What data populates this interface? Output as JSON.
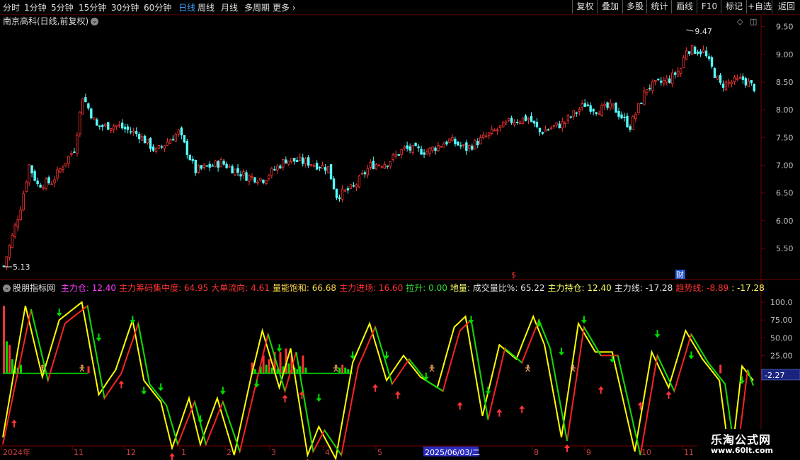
{
  "toolbar": {
    "timeframes": [
      "分时",
      "1分钟",
      "5分钟",
      "15分钟",
      "30分钟",
      "60分钟",
      "日线",
      "周线",
      "月线",
      "多周期",
      "更多"
    ],
    "active_timeframe": "日线",
    "buttons": [
      "复权",
      "叠加",
      "多股",
      "统计",
      "画线",
      "F10",
      "标记",
      "+自选",
      "返回"
    ]
  },
  "stock_title": "南京高科(日线,前复权)",
  "indicator": {
    "name": "股朋指标网",
    "fields": [
      {
        "label": "主力仓:",
        "value": "12.40",
        "color": "#ff40ff"
      },
      {
        "label": "主力筹码集中度:",
        "value": "64.95",
        "color": "#ff3333"
      },
      {
        "label": "大单流向:",
        "value": "4.61",
        "color": "#ff3333"
      },
      {
        "label": "量能饱和:",
        "value": "66.68",
        "color": "#ffd84a"
      },
      {
        "label": "主力进场:",
        "value": "16.60",
        "color": "#ff3333"
      },
      {
        "label": "拉升:",
        "value": "0.00",
        "color": "#33dd33"
      },
      {
        "label": "地量:",
        "value": "",
        "color": "#ffff66"
      },
      {
        "label": "成交量比%:",
        "value": "65.22",
        "color": "#e0e0e0"
      },
      {
        "label": "主力持仓:",
        "value": "12.40",
        "color": "#ffff66"
      },
      {
        "label": "主力线:",
        "value": "-17.28",
        "color": "#e0e0e0"
      },
      {
        "label": "趋势线:",
        "value": "-8.89",
        "color": "#ff3333"
      },
      {
        "label": ":",
        "value": "-17.28",
        "color": "#ffff66"
      }
    ],
    "current_value_badge": "-2.27"
  },
  "markers": {
    "high_label": "9.47",
    "low_label": "5.13",
    "event_letter": "$",
    "event_char": "财"
  },
  "watermark": {
    "title": "乐淘公式网",
    "url": "www.60lt.com"
  },
  "colors": {
    "up": "#ff3333",
    "down": "#54ffff",
    "yellow": "#ffff00",
    "green": "#00e000",
    "grid": "#7a0000",
    "axis_text": "#c0c0c0"
  },
  "chart_data": [
    {
      "type": "candlestick",
      "title": "南京高科(日线,前复权)",
      "ylim": [
        5.13,
        9.47
      ],
      "y_ticks": [
        5.5,
        6.0,
        6.5,
        7.0,
        7.5,
        8.0,
        8.5,
        9.0,
        9.5
      ],
      "x_labels": [
        "2024年",
        "11",
        "12",
        "1",
        "2",
        "3",
        "4",
        "5",
        "2025/06/03/二",
        "8",
        "9",
        "10",
        "11"
      ],
      "highlighted_x_label": "2025/06/03/二",
      "close_anchors": [
        [
          0,
          5.18
        ],
        [
          6,
          6.25
        ],
        [
          9,
          7.0
        ],
        [
          12,
          6.65
        ],
        [
          17,
          6.7
        ],
        [
          25,
          7.3
        ],
        [
          28,
          8.25
        ],
        [
          33,
          7.7
        ],
        [
          40,
          7.72
        ],
        [
          48,
          7.55
        ],
        [
          54,
          7.25
        ],
        [
          62,
          7.6
        ],
        [
          68,
          6.9
        ],
        [
          77,
          7.05
        ],
        [
          86,
          6.8
        ],
        [
          92,
          6.75
        ],
        [
          100,
          7.1
        ],
        [
          108,
          7.05
        ],
        [
          115,
          6.95
        ],
        [
          118,
          6.45
        ],
        [
          124,
          6.6
        ],
        [
          130,
          7.0
        ],
        [
          136,
          7.05
        ],
        [
          142,
          7.3
        ],
        [
          150,
          7.25
        ],
        [
          158,
          7.45
        ],
        [
          164,
          7.3
        ],
        [
          172,
          7.55
        ],
        [
          180,
          7.8
        ],
        [
          186,
          7.85
        ],
        [
          190,
          7.6
        ],
        [
          198,
          7.75
        ],
        [
          206,
          8.1
        ],
        [
          210,
          8.0
        ],
        [
          216,
          8.05
        ],
        [
          222,
          7.7
        ],
        [
          228,
          8.4
        ],
        [
          236,
          8.55
        ],
        [
          240,
          8.75
        ],
        [
          242,
          9.1
        ],
        [
          248,
          9.05
        ],
        [
          254,
          8.45
        ],
        [
          262,
          8.55
        ],
        [
          266,
          8.4
        ]
      ],
      "n_bars": 267
    },
    {
      "type": "line",
      "title": "股朋指标网",
      "ylim": [
        -100,
        115
      ],
      "y_ticks": [
        0.0,
        25.0,
        50.0,
        75.0,
        100.0
      ],
      "series": [
        {
          "name": "",
          "color": "#ffff00",
          "points": [
            [
              0,
              -90
            ],
            [
              8,
              95
            ],
            [
              14,
              -5
            ],
            [
              20,
              75
            ],
            [
              28,
              100
            ],
            [
              34,
              -30
            ],
            [
              40,
              5
            ],
            [
              46,
              75
            ],
            [
              50,
              -10
            ],
            [
              56,
              -40
            ],
            [
              60,
              -105
            ],
            [
              66,
              -35
            ],
            [
              70,
              -100
            ],
            [
              76,
              -35
            ],
            [
              82,
              -115
            ],
            [
              88,
              -5
            ],
            [
              92,
              60
            ],
            [
              98,
              -20
            ],
            [
              102,
              35
            ],
            [
              108,
              -115
            ],
            [
              112,
              -75
            ],
            [
              118,
              -120
            ],
            [
              124,
              15
            ],
            [
              130,
              70
            ],
            [
              136,
              -10
            ],
            [
              142,
              25
            ],
            [
              148,
              -5
            ],
            [
              154,
              -20
            ],
            [
              160,
              65
            ],
            [
              164,
              80
            ],
            [
              170,
              -60
            ],
            [
              176,
              40
            ],
            [
              182,
              20
            ],
            [
              188,
              80
            ],
            [
              192,
              40
            ],
            [
              198,
              -90
            ],
            [
              204,
              70
            ],
            [
              210,
              30
            ],
            [
              216,
              30
            ],
            [
              224,
              -110
            ],
            [
              230,
              30
            ],
            [
              236,
              -20
            ],
            [
              242,
              60
            ],
            [
              248,
              20
            ],
            [
              254,
              -10
            ],
            [
              258,
              -130
            ],
            [
              262,
              10
            ],
            [
              266,
              -10
            ]
          ]
        },
        {
          "name": "",
          "color": "#ff2222",
          "points": [
            [
              0,
              -100
            ],
            [
              10,
              90
            ],
            [
              16,
              -10
            ],
            [
              22,
              70
            ],
            [
              30,
              95
            ],
            [
              36,
              -35
            ],
            [
              42,
              0
            ],
            [
              48,
              70
            ],
            [
              52,
              -15
            ],
            [
              58,
              -45
            ],
            [
              62,
              -100
            ],
            [
              68,
              -40
            ],
            [
              72,
              -100
            ],
            [
              78,
              -40
            ],
            [
              84,
              -110
            ],
            [
              90,
              -10
            ],
            [
              94,
              55
            ],
            [
              100,
              -25
            ],
            [
              104,
              30
            ],
            [
              110,
              -110
            ],
            [
              114,
              -80
            ],
            [
              120,
              -115
            ],
            [
              126,
              10
            ],
            [
              132,
              65
            ],
            [
              138,
              -15
            ],
            [
              144,
              20
            ],
            [
              150,
              -10
            ],
            [
              156,
              -25
            ],
            [
              162,
              60
            ],
            [
              166,
              75
            ],
            [
              172,
              -65
            ],
            [
              178,
              35
            ],
            [
              184,
              15
            ],
            [
              190,
              75
            ],
            [
              194,
              35
            ],
            [
              200,
              -95
            ],
            [
              206,
              65
            ],
            [
              212,
              25
            ],
            [
              218,
              25
            ],
            [
              226,
              -115
            ],
            [
              232,
              25
            ],
            [
              238,
              -25
            ],
            [
              244,
              55
            ],
            [
              250,
              15
            ],
            [
              256,
              -15
            ],
            [
              260,
              -125
            ],
            [
              264,
              5
            ],
            [
              266,
              -17
            ]
          ]
        }
      ],
      "volume_bars": {
        "red": [
          [
            0,
            95
          ],
          [
            2,
            40
          ],
          [
            30,
            10
          ],
          [
            88,
            15
          ],
          [
            92,
            25
          ],
          [
            94,
            20
          ],
          [
            96,
            30
          ],
          [
            98,
            30
          ],
          [
            100,
            35
          ],
          [
            102,
            25
          ],
          [
            106,
            25
          ],
          [
            120,
            12
          ],
          [
            254,
            12
          ]
        ],
        "green": [
          [
            1,
            45
          ],
          [
            3,
            20
          ],
          [
            4,
            10
          ],
          [
            5,
            8
          ],
          [
            6,
            12
          ],
          [
            14,
            5
          ],
          [
            89,
            6
          ],
          [
            91,
            10
          ],
          [
            93,
            12
          ],
          [
            95,
            8
          ],
          [
            97,
            6
          ],
          [
            99,
            10
          ],
          [
            101,
            14
          ],
          [
            103,
            8
          ],
          [
            104,
            6
          ],
          [
            105,
            10
          ],
          [
            107,
            8
          ],
          [
            119,
            8
          ],
          [
            121,
            8
          ],
          [
            122,
            6
          ],
          [
            123,
            4
          ]
        ]
      },
      "signals": {
        "up_arrows": [
          [
            4,
            -65
          ],
          [
            42,
            -10
          ],
          [
            60,
            -112
          ],
          [
            100,
            -30
          ],
          [
            106,
            -25
          ],
          [
            108,
            -120
          ],
          [
            132,
            -15
          ],
          [
            140,
            -25
          ],
          [
            162,
            -40
          ],
          [
            176,
            -50
          ],
          [
            184,
            -45
          ],
          [
            200,
            -100
          ],
          [
            212,
            -18
          ],
          [
            226,
            -40
          ],
          [
            236,
            -25
          ]
        ],
        "down_arrows": [
          [
            20,
            80
          ],
          [
            34,
            45
          ],
          [
            46,
            70
          ],
          [
            50,
            -30
          ],
          [
            56,
            -25
          ],
          [
            70,
            -70
          ],
          [
            78,
            -30
          ],
          [
            90,
            -20
          ],
          [
            98,
            30
          ],
          [
            112,
            -40
          ],
          [
            124,
            20
          ],
          [
            136,
            20
          ],
          [
            150,
            -10
          ],
          [
            166,
            70
          ],
          [
            172,
            -30
          ],
          [
            190,
            65
          ],
          [
            198,
            25
          ],
          [
            206,
            70
          ],
          [
            216,
            15
          ],
          [
            232,
            50
          ],
          [
            244,
            20
          ],
          [
            262,
            -15
          ]
        ],
        "figure_icons": [
          [
            14,
            5
          ],
          [
            28,
            5
          ],
          [
            118,
            5
          ],
          [
            152,
            5
          ],
          [
            186,
            5
          ],
          [
            202,
            5
          ]
        ]
      }
    }
  ]
}
